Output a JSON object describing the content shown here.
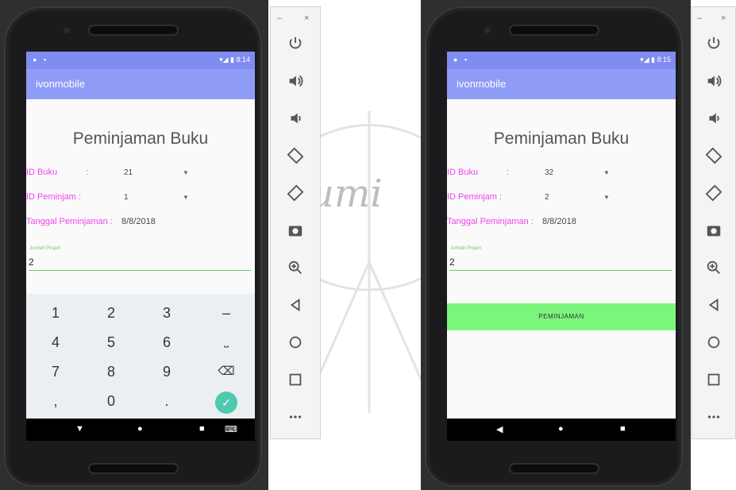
{
  "screens": [
    {
      "status_time": "8:14",
      "app_title": "ivonmobile",
      "form_title": "Peminjaman Buku",
      "id_buku_label": "ID Buku",
      "id_buku_colon": ":",
      "id_buku_value": "21",
      "id_peminjam_label": "ID Peminjam :",
      "id_peminjam_value": "1",
      "tanggal_label": "Tanggal Peminjaman :",
      "tanggal_value": "8/8/2018",
      "jumlah_hint": "Jumlah Pinjam",
      "jumlah_value": "2",
      "keypad": {
        "row1": [
          "1",
          "2",
          "3",
          "–"
        ],
        "row2": [
          "4",
          "5",
          "6",
          "⎵"
        ],
        "row3": [
          "7",
          "8",
          "9",
          "⌫"
        ],
        "row4": [
          ",",
          "0",
          ".",
          "✓"
        ]
      }
    },
    {
      "status_time": "8:15",
      "app_title": "ivonmobile",
      "form_title": "Peminjaman Buku",
      "id_buku_label": "ID Buku",
      "id_buku_colon": ":",
      "id_buku_value": "32",
      "id_peminjam_label": "ID Peminjam :",
      "id_peminjam_value": "2",
      "tanggal_label": "Tanggal Peminjaman :",
      "tanggal_value": "8/8/2018",
      "jumlah_hint": "Jumlah Pinjam",
      "jumlah_value": "2",
      "submit_label": "PEMINJAMAN"
    }
  ],
  "panel": {
    "minimize": "–",
    "close": "×",
    "tools": [
      "power-icon",
      "volume-up-icon",
      "volume-down-icon",
      "rotate-left-icon",
      "rotate-right-icon",
      "camera-icon",
      "zoom-icon",
      "back-icon",
      "home-icon",
      "overview-icon",
      "more-icon"
    ]
  },
  "watermark": "umi",
  "colors": {
    "appbar": "#8f9cf7",
    "label_magenta": "#ee44ee",
    "accent_green": "#67d067",
    "button_green": "#7cf57c",
    "emulator_frame": "#2d2f31"
  }
}
